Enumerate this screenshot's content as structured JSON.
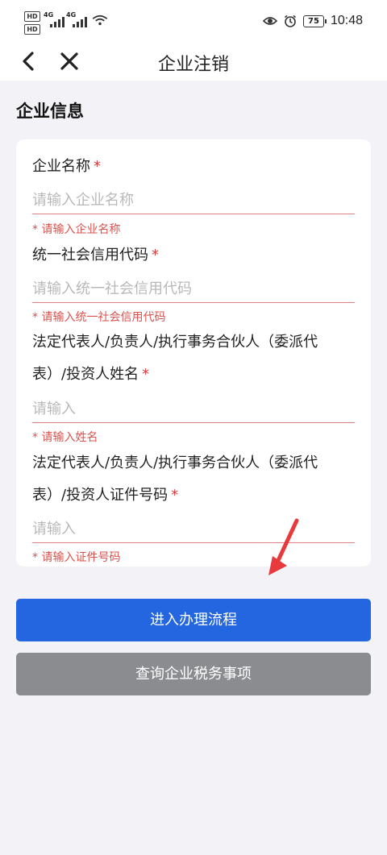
{
  "status_bar": {
    "time": "10:48",
    "battery": "75",
    "signal_labels": [
      "HD",
      "HD",
      "4G",
      "4G"
    ]
  },
  "nav": {
    "title": "企业注销"
  },
  "section": {
    "title": "企业信息"
  },
  "form": {
    "fields": [
      {
        "label": "企业名称",
        "required_mark": "*",
        "placeholder": "请输入企业名称",
        "value": "",
        "error": "* 请输入企业名称"
      },
      {
        "label": "统一社会信用代码",
        "required_mark": "*",
        "placeholder": "请输入统一社会信用代码",
        "value": "",
        "error": "* 请输入统一社会信用代码"
      },
      {
        "label_line1": "法定代表人/负责人/执行事务合伙人（委派代",
        "label_line2": "表）/投资人姓名",
        "required_mark": "*",
        "placeholder": "请输入",
        "value": "",
        "error": "* 请输入姓名"
      },
      {
        "label_line1": "法定代表人/负责人/执行事务合伙人（委派代",
        "label_line2": "表）/投资人证件号码",
        "required_mark": "*",
        "placeholder": "请输入",
        "value": "",
        "error": "* 请输入证件号码"
      }
    ]
  },
  "buttons": {
    "primary": "进入办理流程",
    "secondary": "查询企业税务事项"
  },
  "colors": {
    "primary": "#2466e0",
    "secondary": "#8a8c90",
    "error": "#d9534f",
    "required": "#e03a3a",
    "annotation_arrow": "#e8393c"
  }
}
